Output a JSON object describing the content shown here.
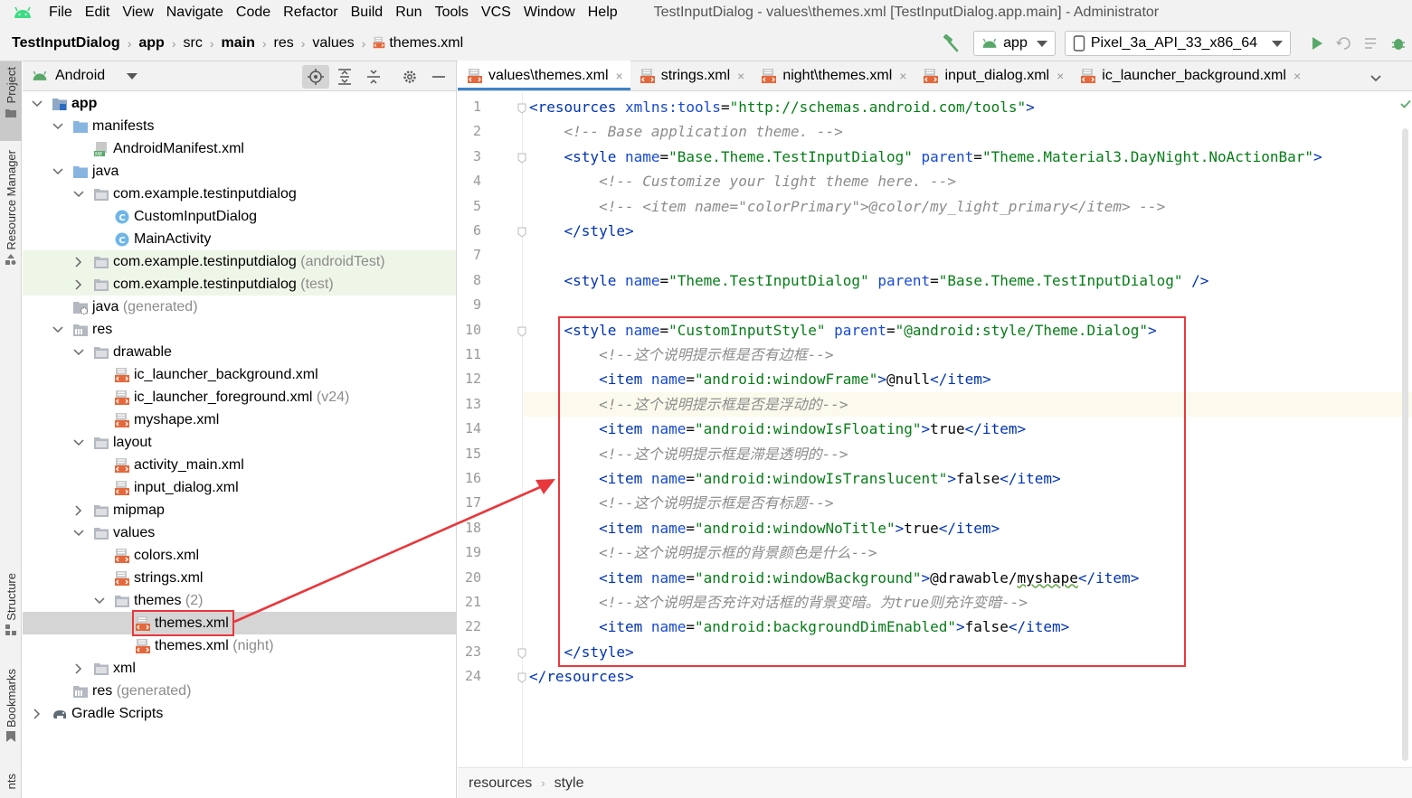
{
  "menubar": {
    "logo_icon": "android-logo-icon",
    "items": [
      "File",
      "Edit",
      "View",
      "Navigate",
      "Code",
      "Refactor",
      "Build",
      "Run",
      "Tools",
      "VCS",
      "Window",
      "Help"
    ],
    "window_title": "TestInputDialog - values\\themes.xml [TestInputDialog.app.main] - Administrator"
  },
  "navbar": {
    "crumbs": [
      "TestInputDialog",
      "app",
      "src",
      "main",
      "res",
      "values",
      "themes.xml"
    ],
    "run_config": "app",
    "device": "Pixel_3a_API_33_x86_64"
  },
  "stripe": {
    "project": "Project",
    "resource_manager": "Resource Manager",
    "structure": "Structure",
    "bookmarks": "Bookmarks",
    "bottom": "nts"
  },
  "project_panel": {
    "view_mode": "Android",
    "tree": [
      {
        "label": "app",
        "hint": "",
        "depth": 0,
        "chev": "down",
        "icon": "module",
        "bold": true
      },
      {
        "label": "manifests",
        "hint": "",
        "depth": 1,
        "chev": "down",
        "icon": "folder-blue"
      },
      {
        "label": "AndroidManifest.xml",
        "hint": "",
        "depth": 2,
        "chev": "",
        "icon": "manifest"
      },
      {
        "label": "java",
        "hint": "",
        "depth": 1,
        "chev": "down",
        "icon": "folder-blue"
      },
      {
        "label": "com.example.testinputdialog",
        "hint": "",
        "depth": 2,
        "chev": "down",
        "icon": "package"
      },
      {
        "label": "CustomInputDialog",
        "hint": "",
        "depth": 3,
        "chev": "",
        "icon": "class"
      },
      {
        "label": "MainActivity",
        "hint": "",
        "depth": 3,
        "chev": "",
        "icon": "class"
      },
      {
        "label": "com.example.testinputdialog",
        "hint": "(androidTest)",
        "depth": 2,
        "chev": "right",
        "icon": "package",
        "tested": true
      },
      {
        "label": "com.example.testinputdialog",
        "hint": "(test)",
        "depth": 2,
        "chev": "right",
        "icon": "package",
        "tested": true
      },
      {
        "label": "java",
        "hint": "(generated)",
        "depth": 1,
        "chev": "",
        "icon": "folder-gen"
      },
      {
        "label": "res",
        "hint": "",
        "depth": 1,
        "chev": "down",
        "icon": "folder-res"
      },
      {
        "label": "drawable",
        "hint": "",
        "depth": 2,
        "chev": "down",
        "icon": "package"
      },
      {
        "label": "ic_launcher_background.xml",
        "hint": "",
        "depth": 3,
        "chev": "",
        "icon": "xml"
      },
      {
        "label": "ic_launcher_foreground.xml",
        "hint": "(v24)",
        "depth": 3,
        "chev": "",
        "icon": "xml"
      },
      {
        "label": "myshape.xml",
        "hint": "",
        "depth": 3,
        "chev": "",
        "icon": "xml"
      },
      {
        "label": "layout",
        "hint": "",
        "depth": 2,
        "chev": "down",
        "icon": "package"
      },
      {
        "label": "activity_main.xml",
        "hint": "",
        "depth": 3,
        "chev": "",
        "icon": "xml"
      },
      {
        "label": "input_dialog.xml",
        "hint": "",
        "depth": 3,
        "chev": "",
        "icon": "xml"
      },
      {
        "label": "mipmap",
        "hint": "",
        "depth": 2,
        "chev": "right",
        "icon": "package"
      },
      {
        "label": "values",
        "hint": "",
        "depth": 2,
        "chev": "down",
        "icon": "package"
      },
      {
        "label": "colors.xml",
        "hint": "",
        "depth": 3,
        "chev": "",
        "icon": "xml"
      },
      {
        "label": "strings.xml",
        "hint": "",
        "depth": 3,
        "chev": "",
        "icon": "xml"
      },
      {
        "label": "themes",
        "hint": "(2)",
        "depth": 3,
        "chev": "down",
        "icon": "package"
      },
      {
        "label": "themes.xml",
        "hint": "",
        "depth": 4,
        "chev": "",
        "icon": "xml",
        "selected": true
      },
      {
        "label": "themes.xml",
        "hint": "(night)",
        "depth": 4,
        "chev": "",
        "icon": "xml"
      },
      {
        "label": "xml",
        "hint": "",
        "depth": 2,
        "chev": "right",
        "icon": "package"
      },
      {
        "label": "res",
        "hint": "(generated)",
        "depth": 1,
        "chev": "",
        "icon": "folder-res"
      },
      {
        "label": "Gradle Scripts",
        "hint": "",
        "depth": 0,
        "chev": "right",
        "icon": "gradle"
      }
    ]
  },
  "editor": {
    "tabs": [
      {
        "label": "values\\themes.xml",
        "active": true
      },
      {
        "label": "strings.xml",
        "active": false
      },
      {
        "label": "night\\themes.xml",
        "active": false
      },
      {
        "label": "input_dialog.xml",
        "active": false
      },
      {
        "label": "ic_launcher_background.xml",
        "active": false
      }
    ],
    "current_line": 13,
    "lines": [
      [
        [
          "tg",
          "<resources "
        ],
        [
          "an",
          "xmlns:tools"
        ],
        [
          "tx",
          "="
        ],
        [
          "av",
          "\"http://schemas.android.com/tools\""
        ],
        [
          "tg",
          ">"
        ]
      ],
      [
        [
          "tx",
          "    "
        ],
        [
          "cm",
          "<!-- Base application theme. -->"
        ]
      ],
      [
        [
          "tx",
          "    "
        ],
        [
          "tg",
          "<style "
        ],
        [
          "an",
          "name"
        ],
        [
          "tx",
          "="
        ],
        [
          "av",
          "\"Base.Theme.TestInputDialog\""
        ],
        [
          "tx",
          " "
        ],
        [
          "an",
          "parent"
        ],
        [
          "tx",
          "="
        ],
        [
          "av",
          "\"Theme.Material3.DayNight.NoActionBar\""
        ],
        [
          "tg",
          ">"
        ]
      ],
      [
        [
          "tx",
          "        "
        ],
        [
          "cm",
          "<!-- Customize your light theme here. -->"
        ]
      ],
      [
        [
          "tx",
          "        "
        ],
        [
          "cm",
          "<!-- <item name=\"colorPrimary\">@color/my_light_primary</item> -->"
        ]
      ],
      [
        [
          "tx",
          "    "
        ],
        [
          "tg",
          "</style>"
        ]
      ],
      [],
      [
        [
          "tx",
          "    "
        ],
        [
          "tg",
          "<style "
        ],
        [
          "an",
          "name"
        ],
        [
          "tx",
          "="
        ],
        [
          "av",
          "\"Theme.TestInputDialog\""
        ],
        [
          "tx",
          " "
        ],
        [
          "an",
          "parent"
        ],
        [
          "tx",
          "="
        ],
        [
          "av",
          "\"Base.Theme.TestInputDialog\""
        ],
        [
          "tx",
          " "
        ],
        [
          "tg",
          "/>"
        ]
      ],
      [],
      [
        [
          "tx",
          "    "
        ],
        [
          "tg",
          "<style "
        ],
        [
          "an",
          "name"
        ],
        [
          "tx",
          "="
        ],
        [
          "av",
          "\"CustomInputStyle\""
        ],
        [
          "tx",
          " "
        ],
        [
          "an",
          "parent"
        ],
        [
          "tx",
          "="
        ],
        [
          "av",
          "\"@android:style/Theme.Dialog\""
        ],
        [
          "tg",
          ">"
        ]
      ],
      [
        [
          "tx",
          "        "
        ],
        [
          "cm",
          "<!--这个说明提示框是否有边框-->"
        ]
      ],
      [
        [
          "tx",
          "        "
        ],
        [
          "tg",
          "<item "
        ],
        [
          "an",
          "name"
        ],
        [
          "tx",
          "="
        ],
        [
          "av",
          "\"android:windowFrame\""
        ],
        [
          "tg",
          ">"
        ],
        [
          "tx",
          "@null"
        ],
        [
          "tg",
          "</item>"
        ]
      ],
      [
        [
          "tx",
          "        "
        ],
        [
          "cm",
          "<!--这个说明提示框是否是浮动的-->"
        ]
      ],
      [
        [
          "tx",
          "        "
        ],
        [
          "tg",
          "<item "
        ],
        [
          "an",
          "name"
        ],
        [
          "tx",
          "="
        ],
        [
          "av",
          "\"android:windowIsFloating\""
        ],
        [
          "tg",
          ">"
        ],
        [
          "tx",
          "true"
        ],
        [
          "tg",
          "</item>"
        ]
      ],
      [
        [
          "tx",
          "        "
        ],
        [
          "cm",
          "<!--这个说明提示框是滞是透明的-->"
        ]
      ],
      [
        [
          "tx",
          "        "
        ],
        [
          "tg",
          "<item "
        ],
        [
          "an",
          "name"
        ],
        [
          "tx",
          "="
        ],
        [
          "av",
          "\"android:windowIsTranslucent\""
        ],
        [
          "tg",
          ">"
        ],
        [
          "tx",
          "false"
        ],
        [
          "tg",
          "</item>"
        ]
      ],
      [
        [
          "tx",
          "        "
        ],
        [
          "cm",
          "<!--这个说明提示框是否有标题-->"
        ]
      ],
      [
        [
          "tx",
          "        "
        ],
        [
          "tg",
          "<item "
        ],
        [
          "an",
          "name"
        ],
        [
          "tx",
          "="
        ],
        [
          "av",
          "\"android:windowNoTitle\""
        ],
        [
          "tg",
          ">"
        ],
        [
          "tx",
          "true"
        ],
        [
          "tg",
          "</item>"
        ]
      ],
      [
        [
          "tx",
          "        "
        ],
        [
          "cm",
          "<!--这个说明提示框的背景颜色是什么-->"
        ]
      ],
      [
        [
          "tx",
          "        "
        ],
        [
          "tg",
          "<item "
        ],
        [
          "an",
          "name"
        ],
        [
          "tx",
          "="
        ],
        [
          "av",
          "\"android:windowBackground\""
        ],
        [
          "tg",
          ">"
        ],
        [
          "tx",
          "@drawable/"
        ],
        [
          "ul",
          "myshape"
        ],
        [
          "tg",
          "</item>"
        ]
      ],
      [
        [
          "tx",
          "        "
        ],
        [
          "cm",
          "<!--这个说明是否充许对话框的背景变暗。为true则充许变暗-->"
        ]
      ],
      [
        [
          "tx",
          "        "
        ],
        [
          "tg",
          "<item "
        ],
        [
          "an",
          "name"
        ],
        [
          "tx",
          "="
        ],
        [
          "av",
          "\"android:backgroundDimEnabled\""
        ],
        [
          "tg",
          ">"
        ],
        [
          "tx",
          "false"
        ],
        [
          "tg",
          "</item>"
        ]
      ],
      [
        [
          "tx",
          "    "
        ],
        [
          "tg",
          "</style>"
        ]
      ],
      [
        [
          "tg",
          "</resources>"
        ]
      ]
    ],
    "breadcrumb": [
      "resources",
      "style"
    ]
  },
  "colors": {
    "annotation_red": "#e8383d",
    "run_green": "#59a869",
    "tag_blue": "#0033b3",
    "value_green": "#067d17"
  }
}
